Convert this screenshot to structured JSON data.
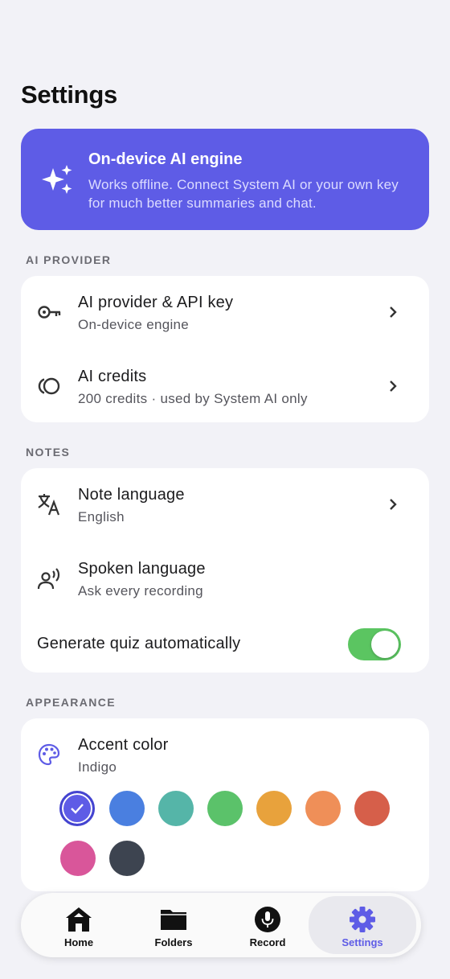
{
  "page": {
    "title": "Settings"
  },
  "banner": {
    "title": "On-device AI engine",
    "subtitle": "Works offline. Connect System AI or your own key for much better summaries and chat.",
    "icon": "sparkles-icon"
  },
  "sections": {
    "ai_provider": {
      "label": "AI PROVIDER",
      "rows": [
        {
          "title": "AI provider & API key",
          "subtitle": "On-device engine",
          "icon": "key-icon"
        },
        {
          "title": "AI credits",
          "subtitle": "200 credits · used by System AI only",
          "icon": "coins-icon"
        }
      ]
    },
    "notes": {
      "label": "NOTES",
      "rows": [
        {
          "title": "Note language",
          "subtitle": "English",
          "icon": "translate-icon"
        },
        {
          "title": "Spoken language",
          "subtitle": "Ask every recording",
          "icon": "speaker-person-icon"
        }
      ],
      "toggle": {
        "label": "Generate quiz automatically",
        "on": true
      }
    },
    "appearance": {
      "label": "APPEARANCE",
      "accent": {
        "title": "Accent color",
        "value": "Indigo",
        "icon": "palette-icon"
      },
      "swatches": [
        {
          "name": "indigo",
          "color": "#5e5ce6",
          "selected": true
        },
        {
          "name": "blue",
          "color": "#4a7fe0",
          "selected": false
        },
        {
          "name": "teal",
          "color": "#55b5a8",
          "selected": false
        },
        {
          "name": "green",
          "color": "#5bc26a",
          "selected": false
        },
        {
          "name": "amber",
          "color": "#e8a23c",
          "selected": false
        },
        {
          "name": "orange",
          "color": "#ef8f58",
          "selected": false
        },
        {
          "name": "red",
          "color": "#d65f4a",
          "selected": false
        },
        {
          "name": "pink",
          "color": "#d9569a",
          "selected": false
        },
        {
          "name": "slate",
          "color": "#3d4450",
          "selected": false
        }
      ]
    }
  },
  "tabbar": {
    "tabs": [
      {
        "label": "Home",
        "icon": "home-icon"
      },
      {
        "label": "Folders",
        "icon": "folder-icon"
      },
      {
        "label": "Record",
        "icon": "microphone-icon"
      },
      {
        "label": "Settings",
        "icon": "gear-icon",
        "active": true
      }
    ]
  },
  "colors": {
    "accent": "#5e5ce6",
    "toggle_on": "#5bc561",
    "background": "#f2f2f7"
  }
}
